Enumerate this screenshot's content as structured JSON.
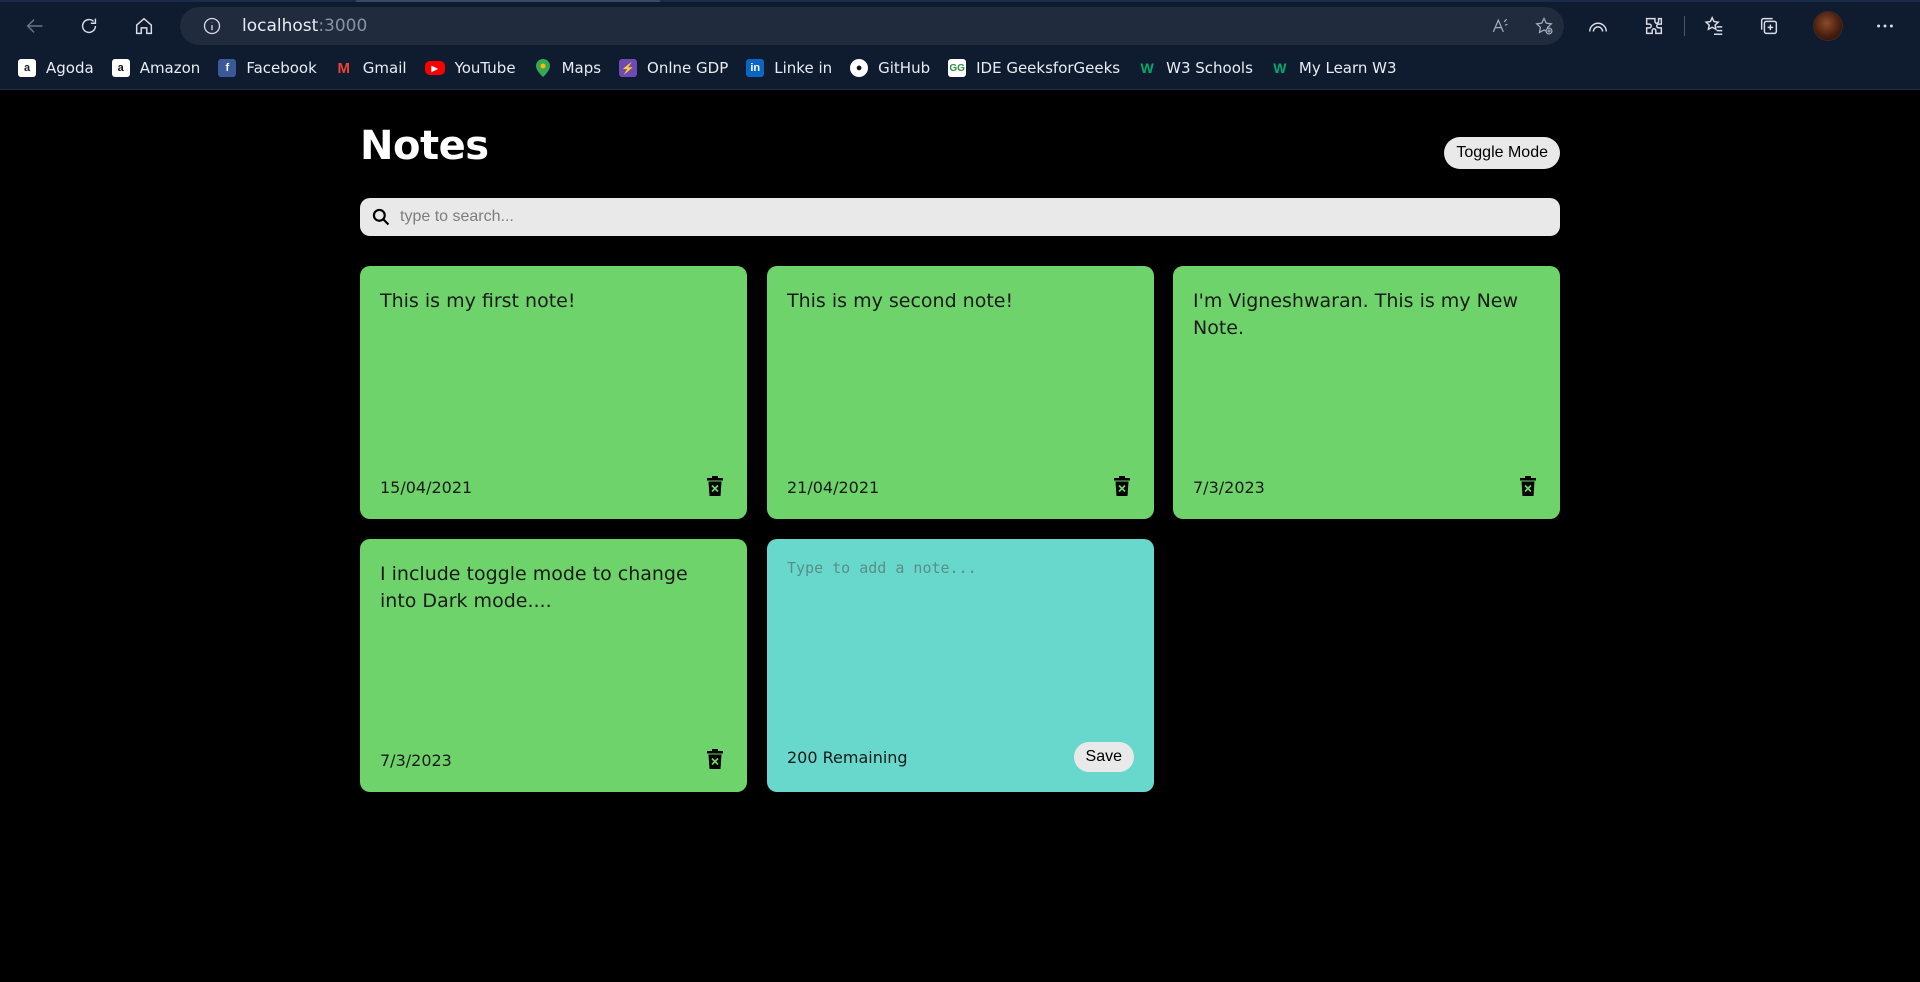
{
  "browser": {
    "url_host": "localhost",
    "url_port": ":3000",
    "bookmarks": [
      {
        "label": "Agoda",
        "icon": "agoda-icon",
        "color": "#ffffff"
      },
      {
        "label": "Amazon",
        "icon": "amazon-icon",
        "color": "#ffffff"
      },
      {
        "label": "Facebook",
        "icon": "facebook-icon",
        "color": "#3b5998"
      },
      {
        "label": "Gmail",
        "icon": "gmail-icon",
        "color": "#ea4335"
      },
      {
        "label": "YouTube",
        "icon": "youtube-icon",
        "color": "#ff0000"
      },
      {
        "label": "Maps",
        "icon": "maps-icon",
        "color": "#34a853"
      },
      {
        "label": "Onlne GDP",
        "icon": "online-gdp-icon",
        "color": "#6e4ab5"
      },
      {
        "label": "Linke in",
        "icon": "linkedin-icon",
        "color": "#0a66c2"
      },
      {
        "label": "GitHub",
        "icon": "github-icon",
        "color": "#ffffff"
      },
      {
        "label": "IDE GeeksforGeeks",
        "icon": "geeksforgeeks-icon",
        "color": "#2f8d46"
      },
      {
        "label": "W3 Schools",
        "icon": "w3schools-icon",
        "color": "#04aa6d"
      },
      {
        "label": "My Learn W3",
        "icon": "w3schools-icon",
        "color": "#04aa6d"
      }
    ]
  },
  "app": {
    "title": "Notes",
    "toggle_label": "Toggle Mode",
    "search_placeholder": "type to search...",
    "notes": [
      {
        "text": "This is my first note!",
        "date": "15/04/2021"
      },
      {
        "text": "This is my second note!",
        "date": "21/04/2021"
      },
      {
        "text": "I'm Vigneshwaran. This is my New Note.",
        "date": "7/3/2023"
      },
      {
        "text": "I include toggle mode to change into Dark mode....",
        "date": "7/3/2023"
      }
    ],
    "new_note": {
      "placeholder": "Type to add a note...",
      "remaining": "200 Remaining",
      "save_label": "Save"
    },
    "colors": {
      "note": "#6fd36b",
      "new_note": "#67d8cb",
      "background": "#000000"
    }
  }
}
